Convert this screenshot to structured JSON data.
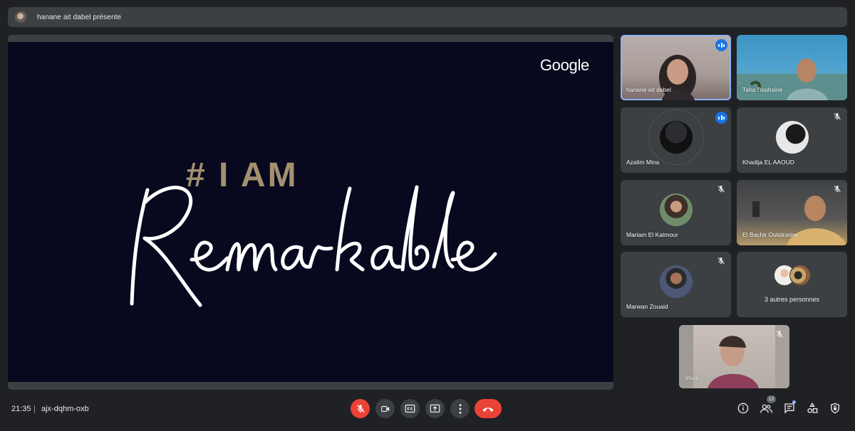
{
  "banner": {
    "text": "hanane ait dabel présente"
  },
  "slide": {
    "brand": "Google",
    "headline_top": "# I AM",
    "headline_script": "Remarkable"
  },
  "participants": [
    {
      "name": "hanane ait dabel",
      "state": "speaking"
    },
    {
      "name": "Taha Bouhsine",
      "state": "video"
    },
    {
      "name": "Azalim Mina",
      "state": "speaking"
    },
    {
      "name": "Khadija EL AAOUD",
      "state": "muted"
    },
    {
      "name": "Mariam El Katmour",
      "state": "muted"
    },
    {
      "name": "El Bachir Outidrarine",
      "state": "muted"
    },
    {
      "name": "Marwan Zouaid",
      "state": "muted"
    },
    {
      "name": "3 autres personnes",
      "state": "group"
    }
  ],
  "self_view": {
    "name": "Vous",
    "state": "muted"
  },
  "bottom": {
    "time": "21:35",
    "separator": "|",
    "meeting_code": "ajx-dqhm-oxb",
    "people_count": "12"
  },
  "colors": {
    "accent": "#8ab4f8",
    "danger": "#ea4335",
    "speaking": "#1a73e8",
    "slide_bg": "#08091f",
    "gold": "#a3906f"
  }
}
